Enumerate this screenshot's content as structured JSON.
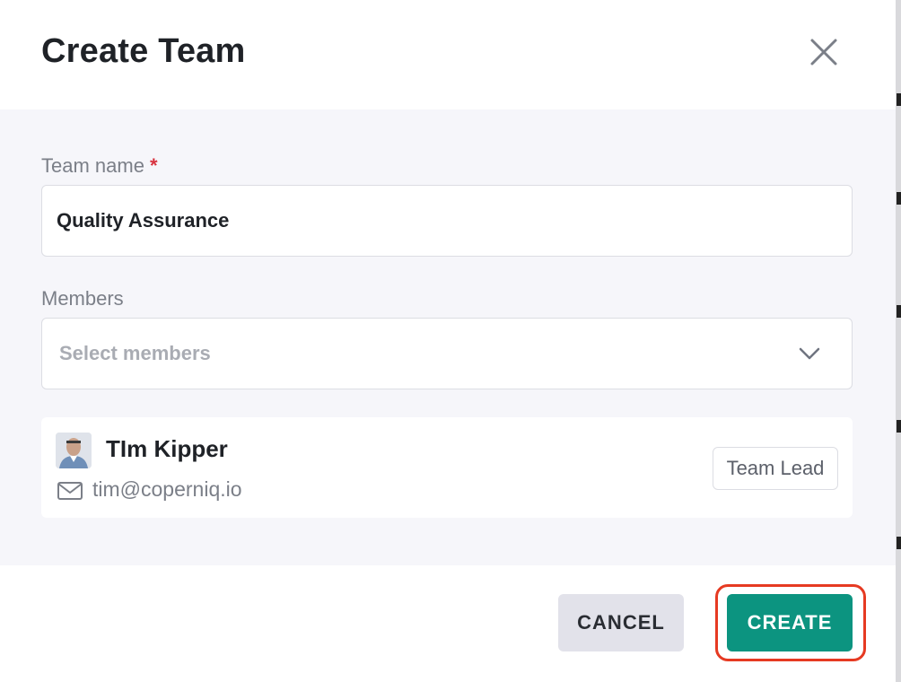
{
  "dialog": {
    "title": "Create Team"
  },
  "form": {
    "team_name": {
      "label": "Team name",
      "required_marker": "*",
      "value": "Quality Assurance"
    },
    "members": {
      "label": "Members",
      "placeholder": "Select members"
    }
  },
  "member_list": [
    {
      "name": "TIm Kipper",
      "email": "tim@coperniq.io",
      "role": "Team Lead"
    }
  ],
  "footer": {
    "cancel_label": "CANCEL",
    "create_label": "CREATE"
  },
  "colors": {
    "primary": "#0c9480",
    "required": "#d8333f",
    "highlight": "#e63a22",
    "body_background": "#f6f6fa"
  }
}
